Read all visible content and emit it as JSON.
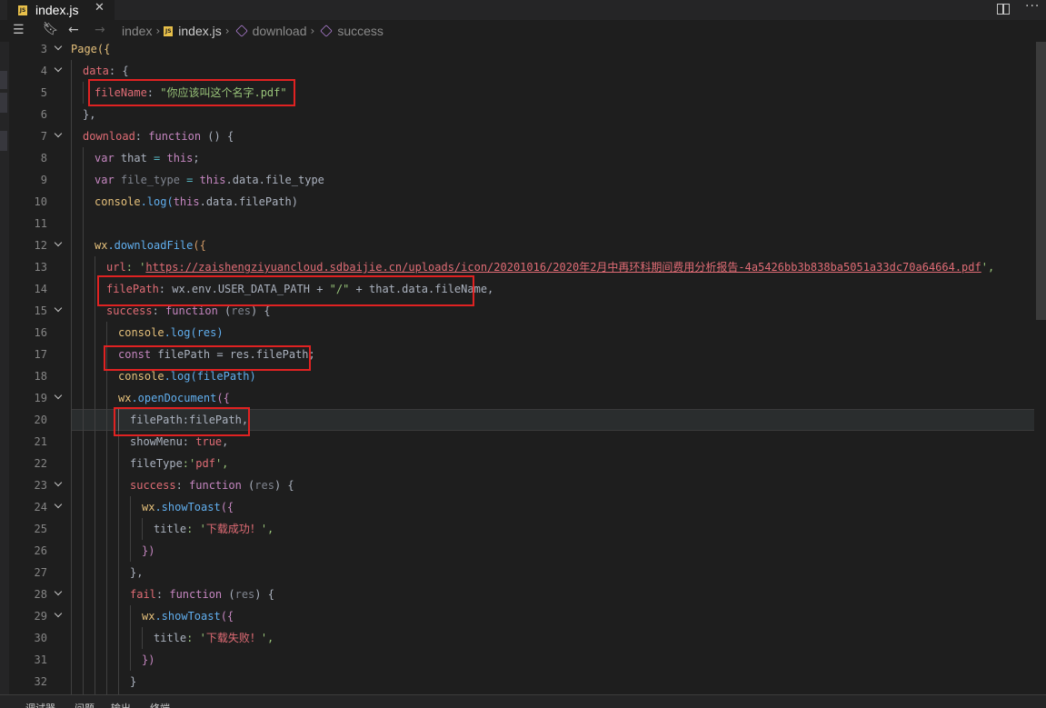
{
  "tab": {
    "icon": "js-file-icon",
    "badge": "JS",
    "label": "index.js",
    "close": "✕"
  },
  "toolbar": {
    "split_icon": "split-editor-icon",
    "more_icon": "more-actions-icon",
    "more": "···"
  },
  "breadcrumb": {
    "items": [
      "index",
      "index.js",
      "download",
      "success"
    ],
    "sep": "›"
  },
  "editor": {
    "line_numbers": [
      "3",
      "4",
      "5",
      "6",
      "7",
      "8",
      "9",
      "10",
      "11",
      "12",
      "13",
      "14",
      "15",
      "16",
      "17",
      "18",
      "19",
      "20",
      "21",
      "22",
      "23",
      "24",
      "25",
      "26",
      "27",
      "28",
      "29",
      "30",
      "31",
      "32"
    ],
    "lines": {
      "l3_a": "Page",
      "l3_b": "({",
      "l4_a": "data",
      "l4_b": ": {",
      "l5_a": "fileName",
      "l5_b": ": ",
      "l5_c": "\"你应该叫这个名字.pdf\"",
      "l6": "},",
      "l7_a": "download",
      "l7_b": ": ",
      "l7_c": "function",
      "l7_d": " () {",
      "l8_a": "var",
      "l8_b": " that ",
      "l8_c": "=",
      "l8_d": " this",
      "l8_e": ";",
      "l9_a": "var",
      "l9_b": " file_type ",
      "l9_c": "=",
      "l9_d": " this",
      "l9_e": ".data.file_type",
      "l10_a": "console",
      "l10_b": ".log(",
      "l10_c": "this",
      "l10_d": ".data.filePath)",
      "l12_a": "wx",
      "l12_b": ".downloadFile",
      "l12_c": "({",
      "l13_a": "url",
      "l13_b": ": '",
      "l13_c": "https://zaishengziyuancloud.sdbaijie.cn/uploads/icon/20201016/2020年2月中再环科期间费用分析报告-4a5426bb3b838ba5051a33dc70a64664.pdf",
      "l13_d": "',",
      "l14_a": "filePath",
      "l14_b": ": wx.env.USER_DATA_PATH + ",
      "l14_c": "\"/\"",
      "l14_d": " + that.data.fileName,",
      "l15_a": "success",
      "l15_b": ": ",
      "l15_c": "function",
      "l15_d": " (",
      "l15_e": "res",
      "l15_f": ") {",
      "l16_a": "console",
      "l16_b": ".log(res)",
      "l17_a": "const",
      "l17_b": " filePath = res.filePath;",
      "l18_a": "console",
      "l18_b": ".log(filePath)",
      "l19_a": "wx",
      "l19_b": ".openDocument",
      "l19_c": "({",
      "l20": "filePath:filePath,",
      "l21_a": "showMenu",
      "l21_b": ": ",
      "l21_c": "true",
      "l21_d": ",",
      "l22_a": "fileType",
      "l22_b": ":'",
      "l22_c": "pdf",
      "l22_d": "',",
      "l23_a": "success",
      "l23_b": ": ",
      "l23_c": "function",
      "l23_d": " (",
      "l23_e": "res",
      "l23_f": ") {",
      "l24_a": "wx",
      "l24_b": ".showToast",
      "l24_c": "({",
      "l25_a": "title",
      "l25_b": ": '",
      "l25_c": "下载成功！",
      "l25_d": "',",
      "l26": "})",
      "l27": "},",
      "l28_a": "fail",
      "l28_b": ": ",
      "l28_c": "function",
      "l28_d": " (",
      "l28_e": "res",
      "l28_f": ") {",
      "l29_a": "wx",
      "l29_b": ".showToast",
      "l29_c": "({",
      "l30_a": "title",
      "l30_b": ": '",
      "l30_c": "下载失败！",
      "l30_d": "',",
      "l31": "})",
      "l32": "}"
    }
  },
  "bottom_panel": {
    "tabs": [
      "调试器",
      "问题",
      "输出",
      "终端"
    ]
  },
  "colors": {
    "highlight_box": "#e02222",
    "background": "#1e1e1e"
  }
}
